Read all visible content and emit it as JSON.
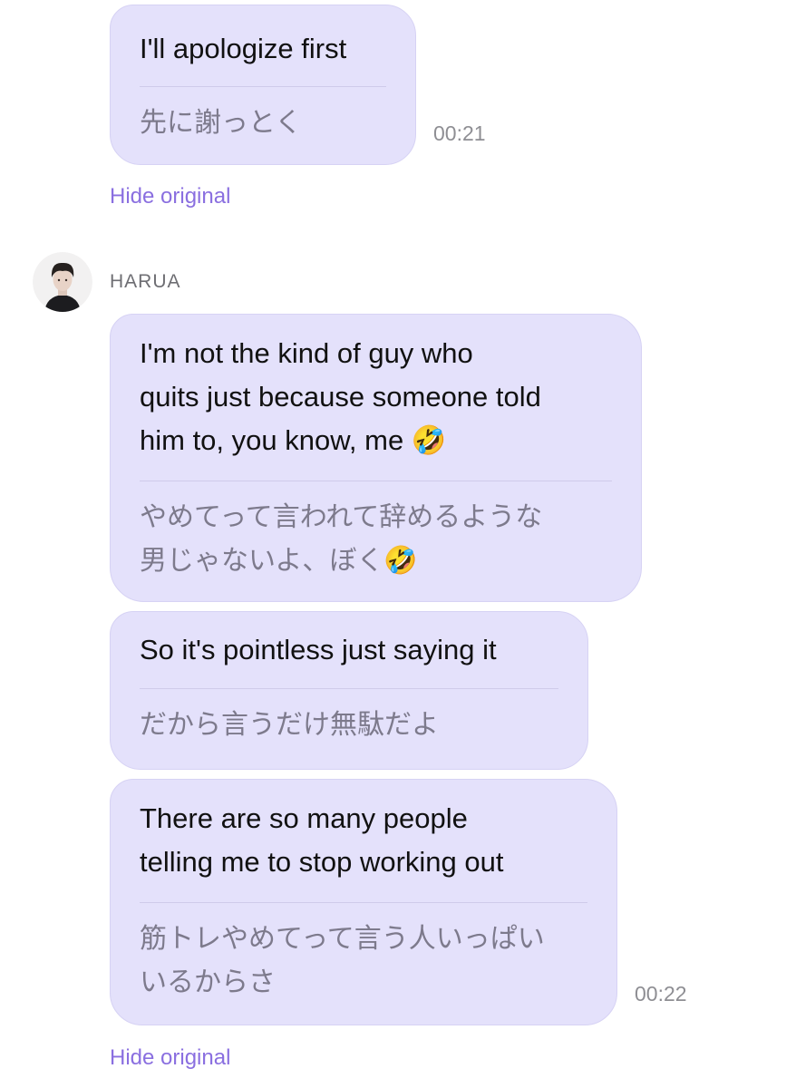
{
  "messages": [
    {
      "en": "I'll apologize first",
      "jp": "先に謝っとく",
      "time": "00:21"
    },
    {
      "en": "I'm not the kind of guy who\nquits just because someone told\nhim to, you know, me 🤣",
      "jp": "やめてって言われて辞めるような\n男じゃないよ、ぼく🤣"
    },
    {
      "en": "So it's pointless just saying it",
      "jp": "だから言うだけ無駄だよ"
    },
    {
      "en": "There are so many people\ntelling me to stop working out",
      "jp": "筋トレやめてって言う人いっぱい\nいるからさ",
      "time": "00:22"
    }
  ],
  "hide_original_label": "Hide original",
  "sender": {
    "name": "HARUA",
    "avatar_icon": "person-avatar"
  },
  "colors": {
    "bubble_bg": "#e4e1fb",
    "link": "#8a6fe0"
  }
}
